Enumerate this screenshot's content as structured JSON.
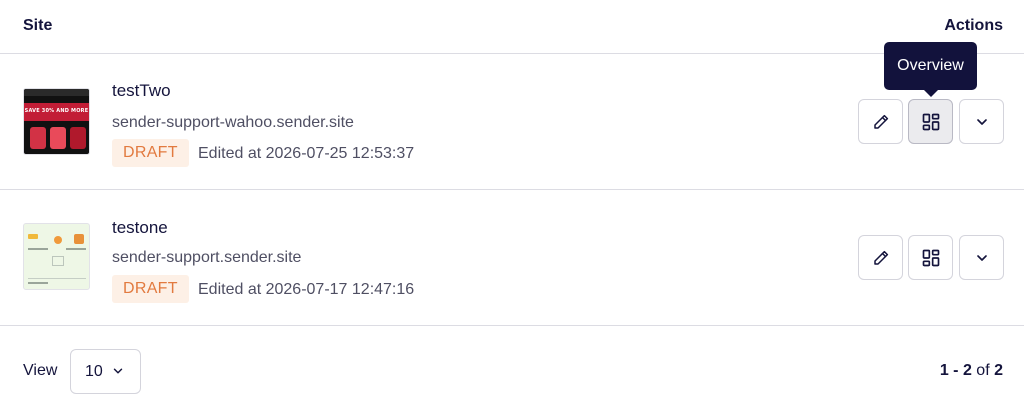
{
  "header": {
    "site_label": "Site",
    "actions_label": "Actions"
  },
  "rows": [
    {
      "name": "testTwo",
      "domain": "sender-support-wahoo.sender.site",
      "status": "DRAFT",
      "edited": "Edited at 2026-07-25 12:53:37",
      "thumbnail_text": "SAVE 30% AND MORE"
    },
    {
      "name": "testone",
      "domain": "sender-support.sender.site",
      "status": "DRAFT",
      "edited": "Edited at 2026-07-17 12:47:16"
    }
  ],
  "tooltip": {
    "label": "Overview"
  },
  "footer": {
    "view_label": "View",
    "page_size": "10",
    "range": "1 - 2",
    "of_label": "of",
    "total": "2"
  },
  "colors": {
    "text_primary": "#14143c",
    "badge_text": "#e27a3f",
    "badge_bg": "#fdf0e6",
    "tooltip_bg": "#12123c",
    "border": "#dcdce3"
  },
  "icons": {
    "edit": "pencil-icon",
    "overview": "grid-icon",
    "more": "chevron-down-icon"
  }
}
